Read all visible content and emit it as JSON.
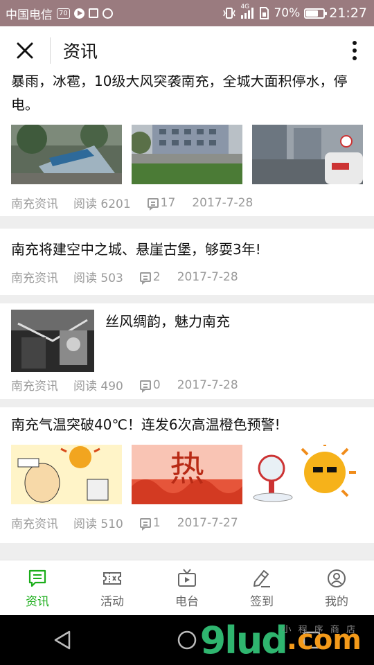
{
  "status_bar": {
    "carrier": "中国电信",
    "badge": "70",
    "network": "4G",
    "battery_text": "70%",
    "battery_level": 0.7,
    "time": "21:27"
  },
  "header": {
    "title": "资讯",
    "close_icon": "close-icon",
    "more_icon": "more-vertical-icon"
  },
  "articles": [
    {
      "title_line1": "暴雨，冰雹，10级大风突袭南充，全城大面积停水，停",
      "title_line2": "电。",
      "source": "南充资讯",
      "reads": "阅读 6201",
      "comments": "17",
      "date": "2017-7-28"
    },
    {
      "title": "南充将建空中之城、悬崖古堡，够耍3年!",
      "source": "南充资讯",
      "reads": "阅读 503",
      "comments": "2",
      "date": "2017-7-28"
    },
    {
      "title": "丝风绸韵，魅力南充",
      "source": "南充资讯",
      "reads": "阅读 490",
      "comments": "0",
      "date": "2017-7-28"
    },
    {
      "title": "南充气温突破40℃！连发6次高温橙色预警!",
      "source": "南充资讯",
      "reads": "阅读 510",
      "comments": "1",
      "date": "2017-7-27",
      "thumb2_text": "热"
    }
  ],
  "tabs": [
    {
      "label": "资讯",
      "icon": "news-icon",
      "active": true
    },
    {
      "label": "活动",
      "icon": "ticket-icon",
      "active": false
    },
    {
      "label": "电台",
      "icon": "radio-tv-icon",
      "active": false
    },
    {
      "label": "签到",
      "icon": "signin-pen-icon",
      "active": false
    },
    {
      "label": "我的",
      "icon": "profile-icon",
      "active": false
    }
  ],
  "watermark": {
    "main": "9lud",
    "suffix": ".com",
    "small": "小 程 序 商 店"
  },
  "colors": {
    "accent": "#1aad19",
    "status_bar": "#9a7b7f",
    "meta_text": "#9a9a9a"
  }
}
